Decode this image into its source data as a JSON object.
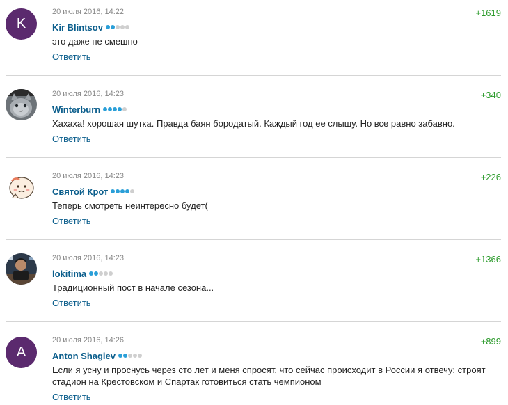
{
  "comments": [
    {
      "date": "20 июля 2016, 14:22",
      "author": "Kir Blintsov",
      "avatar_letter": "K",
      "rating_level": 2,
      "text": "это даже не смешно",
      "reply_label": "Ответить",
      "score": "+1619"
    },
    {
      "date": "20 июля 2016, 14:23",
      "author": "Winterburn",
      "avatar_letter": "",
      "rating_level": 4,
      "text": "Хахаха! хорошая шутка. Правда баян бородатый. Каждый год ее слышу. Но все равно забавно.",
      "reply_label": "Ответить",
      "score": "+340"
    },
    {
      "date": "20 июля 2016, 14:23",
      "author": "Святой Крот",
      "avatar_letter": "",
      "rating_level": 4,
      "text": "Теперь смотреть неинтересно будет(",
      "reply_label": "Ответить",
      "score": "+226"
    },
    {
      "date": "20 июля 2016, 14:23",
      "author": "lokitima",
      "avatar_letter": "",
      "rating_level": 2,
      "text": "Традиционный пост в начале сезона...",
      "reply_label": "Ответить",
      "score": "+1366"
    },
    {
      "date": "20 июля 2016, 14:26",
      "author": "Anton Shagiev",
      "avatar_letter": "A",
      "rating_level": 2,
      "text": "Если я усну и проснусь через сто лет и меня спросят, что сейчас происходит в России я отвечу: строят стадион на Крестовском и Спартак готовиться стать чемпионом",
      "reply_label": "Ответить",
      "score": "+899"
    }
  ],
  "colors": {
    "author": "#0b5e8c",
    "score": "#2a9a2a",
    "avatar_purple": "#5b2a6e",
    "rating_on": "#2a9fd8",
    "rating_off": "#cfcfcf"
  }
}
